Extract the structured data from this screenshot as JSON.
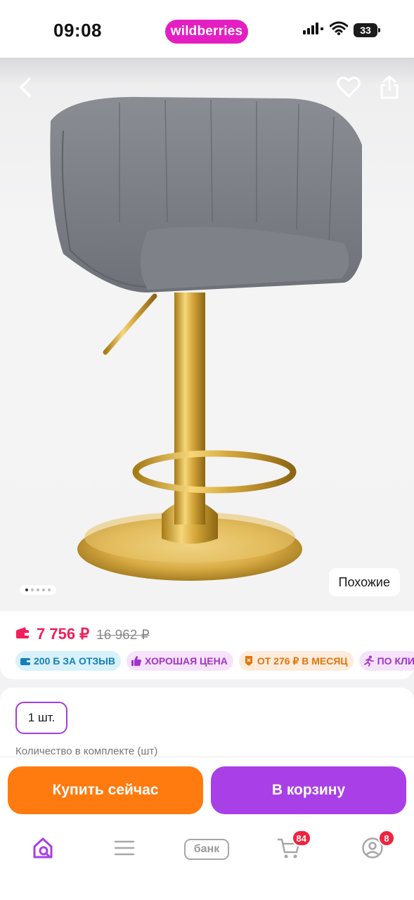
{
  "status_bar": {
    "time": "09:08",
    "brand": "wildberries",
    "battery": "33",
    "icons": [
      "signal-icon",
      "wifi-icon",
      "battery-icon"
    ]
  },
  "gallery": {
    "icons": [
      "back-arrow-icon",
      "heart-icon",
      "share-icon"
    ],
    "similar_label": "Похожие",
    "dots_count": 5,
    "active_dot": 0
  },
  "price": {
    "current": "7 756 ₽",
    "old": "16 962 ₽",
    "current_color": "#f0205a"
  },
  "chips": [
    {
      "label": "200 Б ЗА ОТЗЫВ",
      "icon": "wallet-icon"
    },
    {
      "label": "ХОРОШАЯ ЦЕНА",
      "icon": "thumbs-up-icon"
    },
    {
      "label": "ОТ 276 ₽ В МЕСЯЦ",
      "icon": "installment-icon"
    },
    {
      "label": "ПО КЛИ",
      "icon": "runner-icon"
    }
  ],
  "quantity": {
    "value": "1 шт.",
    "caption": "Количество в комплекте (шт)"
  },
  "actions": {
    "buy_now": "Купить сейчас",
    "add_to_cart": "В корзину",
    "buy_color": "#ff7a0f",
    "cart_color": "#a93fe6"
  },
  "bottom_nav": {
    "items": [
      {
        "icon": "home-search-icon"
      },
      {
        "icon": "menu-icon"
      },
      {
        "icon": "bank-icon",
        "label": "банк"
      },
      {
        "icon": "cart-icon",
        "badge": "84"
      },
      {
        "icon": "profile-icon",
        "badge": "8"
      }
    ]
  },
  "colors": {
    "brand": "#e41ec2",
    "accent_purple": "#a93fe6",
    "badge_red": "#f02340"
  }
}
